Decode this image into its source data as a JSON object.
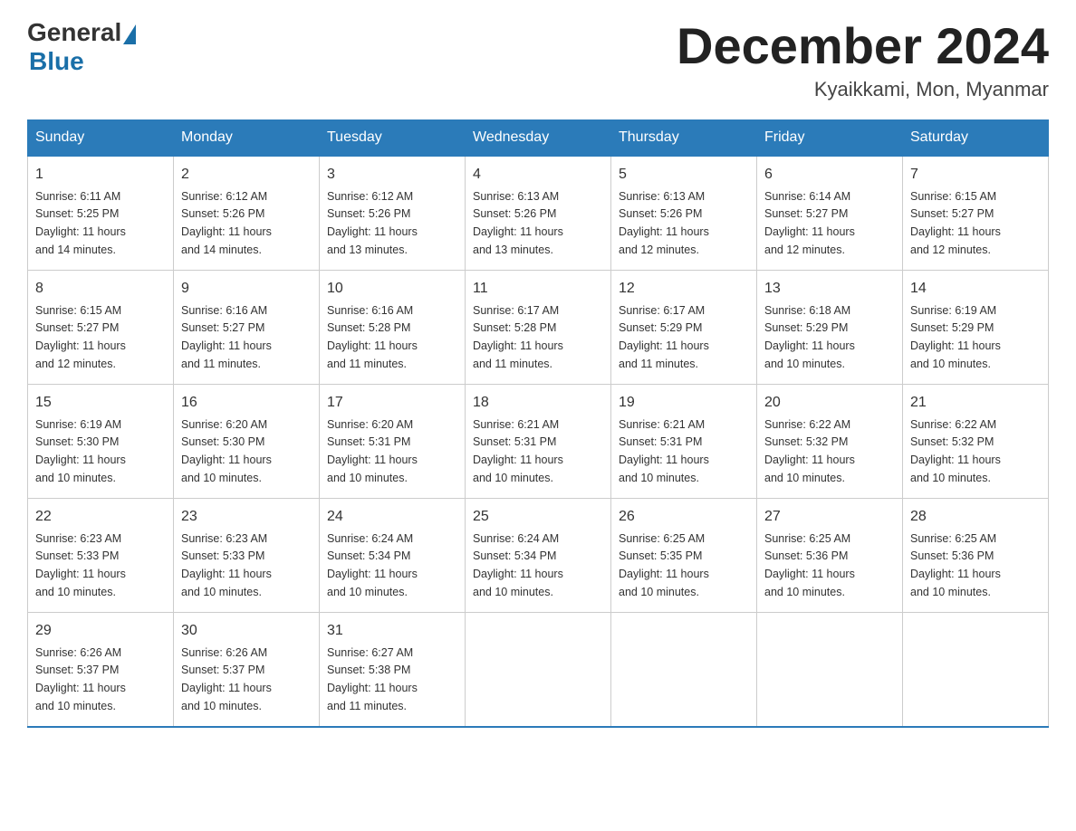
{
  "logo": {
    "general": "General",
    "blue": "Blue"
  },
  "header": {
    "month_title": "December 2024",
    "location": "Kyaikkami, Mon, Myanmar"
  },
  "days_of_week": [
    "Sunday",
    "Monday",
    "Tuesday",
    "Wednesday",
    "Thursday",
    "Friday",
    "Saturday"
  ],
  "weeks": [
    [
      {
        "day": "1",
        "sunrise": "6:11 AM",
        "sunset": "5:25 PM",
        "daylight": "11 hours and 14 minutes."
      },
      {
        "day": "2",
        "sunrise": "6:12 AM",
        "sunset": "5:26 PM",
        "daylight": "11 hours and 14 minutes."
      },
      {
        "day": "3",
        "sunrise": "6:12 AM",
        "sunset": "5:26 PM",
        "daylight": "11 hours and 13 minutes."
      },
      {
        "day": "4",
        "sunrise": "6:13 AM",
        "sunset": "5:26 PM",
        "daylight": "11 hours and 13 minutes."
      },
      {
        "day": "5",
        "sunrise": "6:13 AM",
        "sunset": "5:26 PM",
        "daylight": "11 hours and 12 minutes."
      },
      {
        "day": "6",
        "sunrise": "6:14 AM",
        "sunset": "5:27 PM",
        "daylight": "11 hours and 12 minutes."
      },
      {
        "day": "7",
        "sunrise": "6:15 AM",
        "sunset": "5:27 PM",
        "daylight": "11 hours and 12 minutes."
      }
    ],
    [
      {
        "day": "8",
        "sunrise": "6:15 AM",
        "sunset": "5:27 PM",
        "daylight": "11 hours and 12 minutes."
      },
      {
        "day": "9",
        "sunrise": "6:16 AM",
        "sunset": "5:27 PM",
        "daylight": "11 hours and 11 minutes."
      },
      {
        "day": "10",
        "sunrise": "6:16 AM",
        "sunset": "5:28 PM",
        "daylight": "11 hours and 11 minutes."
      },
      {
        "day": "11",
        "sunrise": "6:17 AM",
        "sunset": "5:28 PM",
        "daylight": "11 hours and 11 minutes."
      },
      {
        "day": "12",
        "sunrise": "6:17 AM",
        "sunset": "5:29 PM",
        "daylight": "11 hours and 11 minutes."
      },
      {
        "day": "13",
        "sunrise": "6:18 AM",
        "sunset": "5:29 PM",
        "daylight": "11 hours and 10 minutes."
      },
      {
        "day": "14",
        "sunrise": "6:19 AM",
        "sunset": "5:29 PM",
        "daylight": "11 hours and 10 minutes."
      }
    ],
    [
      {
        "day": "15",
        "sunrise": "6:19 AM",
        "sunset": "5:30 PM",
        "daylight": "11 hours and 10 minutes."
      },
      {
        "day": "16",
        "sunrise": "6:20 AM",
        "sunset": "5:30 PM",
        "daylight": "11 hours and 10 minutes."
      },
      {
        "day": "17",
        "sunrise": "6:20 AM",
        "sunset": "5:31 PM",
        "daylight": "11 hours and 10 minutes."
      },
      {
        "day": "18",
        "sunrise": "6:21 AM",
        "sunset": "5:31 PM",
        "daylight": "11 hours and 10 minutes."
      },
      {
        "day": "19",
        "sunrise": "6:21 AM",
        "sunset": "5:31 PM",
        "daylight": "11 hours and 10 minutes."
      },
      {
        "day": "20",
        "sunrise": "6:22 AM",
        "sunset": "5:32 PM",
        "daylight": "11 hours and 10 minutes."
      },
      {
        "day": "21",
        "sunrise": "6:22 AM",
        "sunset": "5:32 PM",
        "daylight": "11 hours and 10 minutes."
      }
    ],
    [
      {
        "day": "22",
        "sunrise": "6:23 AM",
        "sunset": "5:33 PM",
        "daylight": "11 hours and 10 minutes."
      },
      {
        "day": "23",
        "sunrise": "6:23 AM",
        "sunset": "5:33 PM",
        "daylight": "11 hours and 10 minutes."
      },
      {
        "day": "24",
        "sunrise": "6:24 AM",
        "sunset": "5:34 PM",
        "daylight": "11 hours and 10 minutes."
      },
      {
        "day": "25",
        "sunrise": "6:24 AM",
        "sunset": "5:34 PM",
        "daylight": "11 hours and 10 minutes."
      },
      {
        "day": "26",
        "sunrise": "6:25 AM",
        "sunset": "5:35 PM",
        "daylight": "11 hours and 10 minutes."
      },
      {
        "day": "27",
        "sunrise": "6:25 AM",
        "sunset": "5:36 PM",
        "daylight": "11 hours and 10 minutes."
      },
      {
        "day": "28",
        "sunrise": "6:25 AM",
        "sunset": "5:36 PM",
        "daylight": "11 hours and 10 minutes."
      }
    ],
    [
      {
        "day": "29",
        "sunrise": "6:26 AM",
        "sunset": "5:37 PM",
        "daylight": "11 hours and 10 minutes."
      },
      {
        "day": "30",
        "sunrise": "6:26 AM",
        "sunset": "5:37 PM",
        "daylight": "11 hours and 10 minutes."
      },
      {
        "day": "31",
        "sunrise": "6:27 AM",
        "sunset": "5:38 PM",
        "daylight": "11 hours and 11 minutes."
      },
      null,
      null,
      null,
      null
    ]
  ],
  "labels": {
    "sunrise": "Sunrise:",
    "sunset": "Sunset:",
    "daylight": "Daylight:"
  }
}
